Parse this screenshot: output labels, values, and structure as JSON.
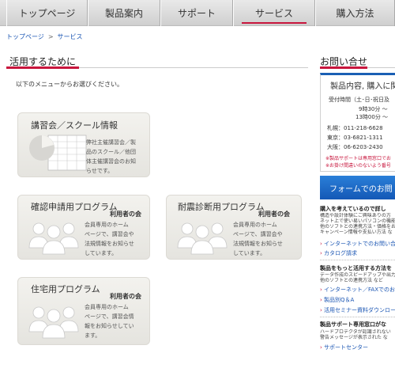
{
  "nav": {
    "items": [
      "トップページ",
      "製品案内",
      "サポート",
      "サービス",
      "購入方法"
    ],
    "active_index": 3
  },
  "breadcrumb": {
    "home": "トップページ",
    "sep": ">",
    "current": "サービス"
  },
  "main": {
    "title": "活用するために",
    "lead": "以下のメニューからお選びください。"
  },
  "cards": [
    {
      "title": "講習会／スクール情報",
      "sub": "",
      "desc": [
        "弊社主催講習会／製",
        "品のスクール／他団",
        "体主催講習会のお知",
        "らせです。"
      ]
    },
    {
      "title": "確認申請用プログラム",
      "sub": "利用者の会",
      "desc": [
        "会員専用のホーム",
        "ページで、講習会や",
        "法規情報をお知らせ",
        "しています。"
      ]
    },
    {
      "title": "耐震診断用プログラム",
      "sub": "利用者の会",
      "desc": [
        "会員専用のホーム",
        "ページで、講習会や",
        "法規情報をお知らせ",
        "しています。"
      ]
    },
    {
      "title": "住宅用プログラム",
      "sub": "利用者の会",
      "desc": [
        "会員専用のホーム",
        "ページで、講習会情",
        "報をお知らせしてい",
        "ます。"
      ]
    }
  ],
  "contact": {
    "title": "お問い合せ",
    "box_title": "製品内容, 購入に関",
    "hours1": "受付時間（土･日･祝日及",
    "hours2": "9時30分 ～",
    "hours3": "13時00分 ～",
    "sapporo": "札幌：011-218-6628",
    "tokyo": "東京：03-6821-1311",
    "osaka": "大阪：06-6203-2430",
    "note1": "※製品サポートは専用窓口でお",
    "note2": "※お掛け間違いのないよう番号",
    "form_button": "フォームでのお問"
  },
  "side": {
    "h1": "購入を考えているので詳し",
    "t1": [
      "構造や設計体験にご興味ありの方",
      "ネット上で使い易いパソコンの機能が",
      "他のソフトとの連携方法・価格をお",
      "キャンペーン情報や支払い方法 な"
    ],
    "l1": [
      "インターネットでのお問い合",
      "カタログ請求"
    ],
    "h2": "製品をもっと活用する方法を",
    "t2": [
      "データ作成のスピードアップや出力",
      "他のソフトとの連携方法 など"
    ],
    "l2": [
      "インターネット／FAXでのお",
      "製品別Q＆A",
      "活用セミナー資料ダウンロー"
    ],
    "h3": "製品サポート専用窓口がな",
    "t3": [
      "ハードプロテクタが認識されない",
      "警告メッセージが表示された な"
    ],
    "l3": [
      "サポートセンター"
    ]
  }
}
